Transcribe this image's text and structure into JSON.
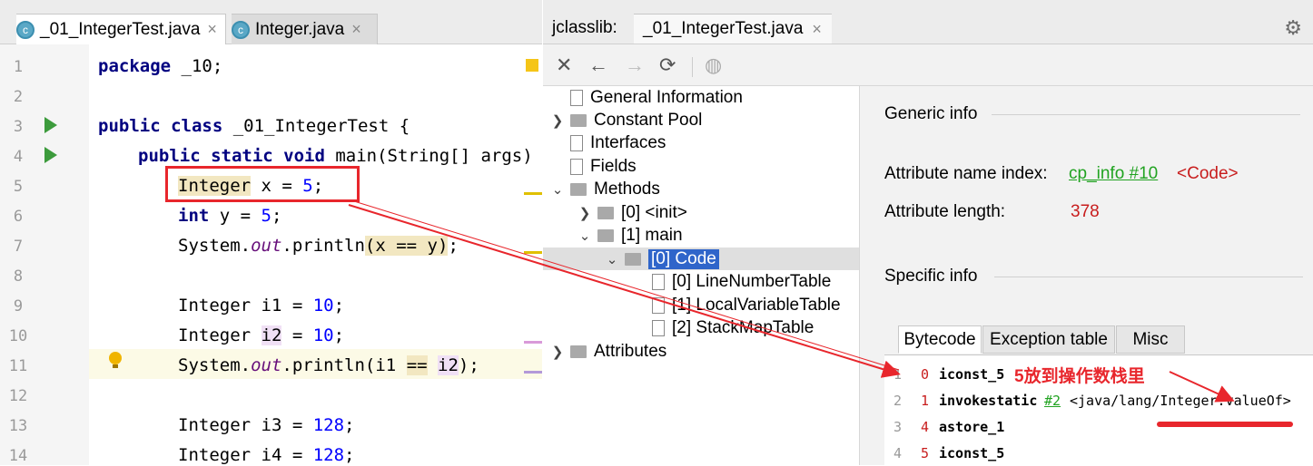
{
  "editor": {
    "tabs": [
      {
        "label": "_01_IntegerTest.java",
        "icon": "java-class-icon"
      },
      {
        "label": "Integer.java",
        "icon": "java-class-icon"
      }
    ],
    "lines": [
      {
        "n": "1",
        "code": "package _10;"
      },
      {
        "n": "2",
        "code": ""
      },
      {
        "n": "3",
        "code": "public class _01_IntegerTest {"
      },
      {
        "n": "4",
        "code": "public static void main(String[] args) {"
      },
      {
        "n": "5",
        "code": "Integer x = 5;"
      },
      {
        "n": "6",
        "code": "int y = 5;"
      },
      {
        "n": "7",
        "code": "System.out.println(x == y);"
      },
      {
        "n": "8",
        "code": ""
      },
      {
        "n": "9",
        "code": "Integer i1 = 10;"
      },
      {
        "n": "10",
        "code": "Integer i2 = 10;"
      },
      {
        "n": "11",
        "code": "System.out.println(i1 == i2);"
      },
      {
        "n": "12",
        "code": ""
      },
      {
        "n": "13",
        "code": "Integer i3 = 128;"
      },
      {
        "n": "14",
        "code": "Integer i4 = 128;"
      }
    ]
  },
  "jclasslib": {
    "title": "jclasslib:",
    "tab_label": "_01_IntegerTest.java",
    "toolbar": [
      "close-icon",
      "back-icon",
      "forward-icon",
      "refresh-icon",
      "web-icon"
    ],
    "tree": [
      "General Information",
      "Constant Pool",
      "Interfaces",
      "Fields",
      "Methods",
      "[0] <init>",
      "[1] main",
      "[0] Code",
      "[0] LineNumberTable",
      "[1] LocalVariableTable",
      "[2] StackMapTable",
      "Attributes"
    ],
    "detail": {
      "generic_title": "Generic info",
      "name_index_label": "Attribute name index:",
      "name_index_link": "cp_info #10",
      "name_index_value": "<Code>",
      "length_label": "Attribute length:",
      "length_value": "378",
      "specific_title": "Specific info",
      "subtabs": [
        "Bytecode",
        "Exception table",
        "Misc"
      ],
      "bytecode": [
        {
          "ln": "1",
          "off": "0",
          "op": "iconst_5",
          "arg": ""
        },
        {
          "ln": "2",
          "off": "1",
          "op": "invokestatic",
          "ref": "#2",
          "arg": "<java/lang/Integer.valueOf>"
        },
        {
          "ln": "3",
          "off": "4",
          "op": "astore_1",
          "arg": ""
        },
        {
          "ln": "4",
          "off": "5",
          "op": "iconst_5",
          "arg": ""
        }
      ]
    }
  },
  "annotation": {
    "text": "5放到操作数栈里"
  },
  "colors": {
    "annotation_red": "#e8262c",
    "selection_blue": "#2f65ca",
    "link_green": "#21a321"
  }
}
